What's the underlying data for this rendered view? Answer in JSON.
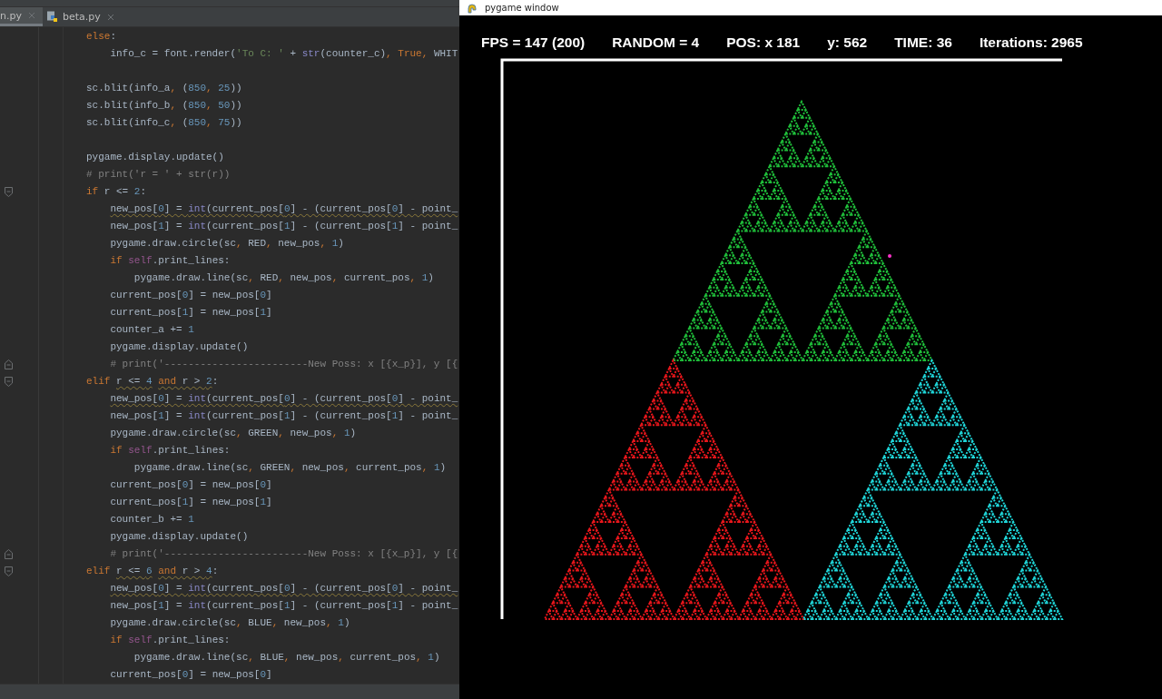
{
  "editor": {
    "tabs": [
      {
        "label": "n.py",
        "selected": true,
        "icon": false
      },
      {
        "label": "beta.py",
        "selected": false,
        "icon": true
      }
    ],
    "lines": [
      {
        "kind": "code",
        "segments": [
          {
            "text": "else",
            "kind": "keyword"
          },
          {
            "text": ":",
            "kind": "plain"
          }
        ]
      },
      {
        "kind": "code",
        "segments": [
          {
            "text": "    info_c = font.render(",
            "kind": "plain"
          },
          {
            "text": "'To C: '",
            "kind": "string"
          },
          {
            "text": " + ",
            "kind": "plain"
          },
          {
            "text": "str",
            "kind": "builtin"
          },
          {
            "text": "(counter_c)",
            "kind": "plain"
          },
          {
            "text": ", True, ",
            "kind": "keyword"
          },
          {
            "text": "WHIT",
            "kind": "plain"
          }
        ]
      },
      {
        "kind": "blank"
      },
      {
        "kind": "code",
        "segments": [
          {
            "text": "sc.blit(info_a",
            "kind": "plain"
          },
          {
            "text": ", ",
            "kind": "keyword"
          },
          {
            "text": "(",
            "kind": "plain"
          },
          {
            "text": "850",
            "kind": "number"
          },
          {
            "text": ", ",
            "kind": "keyword"
          },
          {
            "text": "25",
            "kind": "number"
          },
          {
            "text": "))",
            "kind": "plain"
          }
        ]
      },
      {
        "kind": "code",
        "segments": [
          {
            "text": "sc.blit(info_b",
            "kind": "plain"
          },
          {
            "text": ", ",
            "kind": "keyword"
          },
          {
            "text": "(",
            "kind": "plain"
          },
          {
            "text": "850",
            "kind": "number"
          },
          {
            "text": ", ",
            "kind": "keyword"
          },
          {
            "text": "50",
            "kind": "number"
          },
          {
            "text": "))",
            "kind": "plain"
          }
        ]
      },
      {
        "kind": "code",
        "segments": [
          {
            "text": "sc.blit(info_c",
            "kind": "plain"
          },
          {
            "text": ", ",
            "kind": "keyword"
          },
          {
            "text": "(",
            "kind": "plain"
          },
          {
            "text": "850",
            "kind": "number"
          },
          {
            "text": ", ",
            "kind": "keyword"
          },
          {
            "text": "75",
            "kind": "number"
          },
          {
            "text": "))",
            "kind": "plain"
          }
        ]
      },
      {
        "kind": "blank"
      },
      {
        "kind": "code",
        "segments": [
          {
            "text": "pygame.display.update()",
            "kind": "plain"
          }
        ]
      },
      {
        "kind": "code",
        "segments": [
          {
            "text": "# print('r = ' + str(r))",
            "kind": "comment"
          }
        ]
      },
      {
        "kind": "code",
        "fold_start": true,
        "segments": [
          {
            "text": "if ",
            "kind": "keyword"
          },
          {
            "text": "r <= ",
            "kind": "plain"
          },
          {
            "text": "2",
            "kind": "number"
          },
          {
            "text": ":",
            "kind": "plain"
          }
        ]
      },
      {
        "kind": "code",
        "segments": [
          {
            "text": "    new_pos[",
            "kind": "plain",
            "warning": true
          },
          {
            "text": "0",
            "kind": "number",
            "warning": true
          },
          {
            "text": "] = ",
            "kind": "plain",
            "warning": true
          },
          {
            "text": "int",
            "kind": "builtin",
            "warning": true
          },
          {
            "text": "(current_pos[",
            "kind": "plain",
            "warning": true
          },
          {
            "text": "0",
            "kind": "number",
            "warning": true
          },
          {
            "text": "] - (current_pos[",
            "kind": "plain",
            "warning": true
          },
          {
            "text": "0",
            "kind": "number",
            "warning": true
          },
          {
            "text": "] - point_",
            "kind": "plain",
            "warning": true
          }
        ]
      },
      {
        "kind": "code",
        "segments": [
          {
            "text": "    new_pos[",
            "kind": "plain"
          },
          {
            "text": "1",
            "kind": "number"
          },
          {
            "text": "] = ",
            "kind": "plain"
          },
          {
            "text": "int",
            "kind": "builtin"
          },
          {
            "text": "(current_pos[",
            "kind": "plain"
          },
          {
            "text": "1",
            "kind": "number"
          },
          {
            "text": "] - (current_pos[",
            "kind": "plain"
          },
          {
            "text": "1",
            "kind": "number"
          },
          {
            "text": "] - point_",
            "kind": "plain"
          }
        ]
      },
      {
        "kind": "code",
        "segments": [
          {
            "text": "    pygame.draw.circle(sc",
            "kind": "plain"
          },
          {
            "text": ", ",
            "kind": "keyword"
          },
          {
            "text": "RED",
            "kind": "plain"
          },
          {
            "text": ", ",
            "kind": "keyword"
          },
          {
            "text": "new_pos",
            "kind": "plain"
          },
          {
            "text": ", ",
            "kind": "keyword"
          },
          {
            "text": "1",
            "kind": "number"
          },
          {
            "text": ")",
            "kind": "plain"
          }
        ]
      },
      {
        "kind": "code",
        "segments": [
          {
            "text": "    if ",
            "kind": "keyword"
          },
          {
            "text": "self",
            "kind": "self"
          },
          {
            "text": ".print_lines:",
            "kind": "plain"
          }
        ]
      },
      {
        "kind": "code",
        "segments": [
          {
            "text": "        pygame.draw.line(sc",
            "kind": "plain"
          },
          {
            "text": ", ",
            "kind": "keyword"
          },
          {
            "text": "RED",
            "kind": "plain"
          },
          {
            "text": ", ",
            "kind": "keyword"
          },
          {
            "text": "new_pos",
            "kind": "plain"
          },
          {
            "text": ", ",
            "kind": "keyword"
          },
          {
            "text": "current_pos",
            "kind": "plain"
          },
          {
            "text": ", ",
            "kind": "keyword"
          },
          {
            "text": "1",
            "kind": "number"
          },
          {
            "text": ")",
            "kind": "plain"
          }
        ]
      },
      {
        "kind": "code",
        "segments": [
          {
            "text": "    current_pos[",
            "kind": "plain"
          },
          {
            "text": "0",
            "kind": "number"
          },
          {
            "text": "] = new_pos[",
            "kind": "plain"
          },
          {
            "text": "0",
            "kind": "number"
          },
          {
            "text": "]",
            "kind": "plain"
          }
        ]
      },
      {
        "kind": "code",
        "segments": [
          {
            "text": "    current_pos[",
            "kind": "plain"
          },
          {
            "text": "1",
            "kind": "number"
          },
          {
            "text": "] = new_pos[",
            "kind": "plain"
          },
          {
            "text": "1",
            "kind": "number"
          },
          {
            "text": "]",
            "kind": "plain"
          }
        ]
      },
      {
        "kind": "code",
        "segments": [
          {
            "text": "    counter_a += ",
            "kind": "plain"
          },
          {
            "text": "1",
            "kind": "number"
          }
        ]
      },
      {
        "kind": "code",
        "segments": [
          {
            "text": "    pygame.display.update()",
            "kind": "plain"
          }
        ]
      },
      {
        "kind": "code",
        "fold_end": true,
        "segments": [
          {
            "text": "    # print('------------------------New Poss: x [{x_p}], y [{",
            "kind": "comment"
          }
        ]
      },
      {
        "kind": "code",
        "fold_start": true,
        "segments": [
          {
            "text": "elif ",
            "kind": "keyword"
          },
          {
            "text": "r <= ",
            "kind": "plain",
            "warning": true
          },
          {
            "text": "4",
            "kind": "number",
            "warning": true
          },
          {
            "text": " and ",
            "kind": "keyword",
            "warning": true
          },
          {
            "text": "r > ",
            "kind": "plain",
            "warning": true
          },
          {
            "text": "2",
            "kind": "number",
            "warning": true
          },
          {
            "text": ":",
            "kind": "plain"
          }
        ]
      },
      {
        "kind": "code",
        "segments": [
          {
            "text": "    new_pos[",
            "kind": "plain",
            "warning": true
          },
          {
            "text": "0",
            "kind": "number",
            "warning": true
          },
          {
            "text": "] = ",
            "kind": "plain",
            "warning": true
          },
          {
            "text": "int",
            "kind": "builtin",
            "warning": true
          },
          {
            "text": "(current_pos[",
            "kind": "plain",
            "warning": true
          },
          {
            "text": "0",
            "kind": "number",
            "warning": true
          },
          {
            "text": "] - (current_pos[",
            "kind": "plain",
            "warning": true
          },
          {
            "text": "0",
            "kind": "number",
            "warning": true
          },
          {
            "text": "] - point_",
            "kind": "plain",
            "warning": true
          }
        ]
      },
      {
        "kind": "code",
        "segments": [
          {
            "text": "    new_pos[",
            "kind": "plain"
          },
          {
            "text": "1",
            "kind": "number"
          },
          {
            "text": "] = ",
            "kind": "plain"
          },
          {
            "text": "int",
            "kind": "builtin"
          },
          {
            "text": "(current_pos[",
            "kind": "plain"
          },
          {
            "text": "1",
            "kind": "number"
          },
          {
            "text": "] - (current_pos[",
            "kind": "plain"
          },
          {
            "text": "1",
            "kind": "number"
          },
          {
            "text": "] - point_",
            "kind": "plain"
          }
        ]
      },
      {
        "kind": "code",
        "segments": [
          {
            "text": "    pygame.draw.circle(sc",
            "kind": "plain"
          },
          {
            "text": ", ",
            "kind": "keyword"
          },
          {
            "text": "GREEN",
            "kind": "plain"
          },
          {
            "text": ", ",
            "kind": "keyword"
          },
          {
            "text": "new_pos",
            "kind": "plain"
          },
          {
            "text": ", ",
            "kind": "keyword"
          },
          {
            "text": "1",
            "kind": "number"
          },
          {
            "text": ")",
            "kind": "plain"
          }
        ]
      },
      {
        "kind": "code",
        "segments": [
          {
            "text": "    if ",
            "kind": "keyword"
          },
          {
            "text": "self",
            "kind": "self"
          },
          {
            "text": ".print_lines:",
            "kind": "plain"
          }
        ]
      },
      {
        "kind": "code",
        "segments": [
          {
            "text": "        pygame.draw.line(sc",
            "kind": "plain"
          },
          {
            "text": ", ",
            "kind": "keyword"
          },
          {
            "text": "GREEN",
            "kind": "plain"
          },
          {
            "text": ", ",
            "kind": "keyword"
          },
          {
            "text": "new_pos",
            "kind": "plain"
          },
          {
            "text": ", ",
            "kind": "keyword"
          },
          {
            "text": "current_pos",
            "kind": "plain"
          },
          {
            "text": ", ",
            "kind": "keyword"
          },
          {
            "text": "1",
            "kind": "number"
          },
          {
            "text": ")",
            "kind": "plain"
          }
        ]
      },
      {
        "kind": "code",
        "segments": [
          {
            "text": "    current_pos[",
            "kind": "plain"
          },
          {
            "text": "0",
            "kind": "number"
          },
          {
            "text": "] = new_pos[",
            "kind": "plain"
          },
          {
            "text": "0",
            "kind": "number"
          },
          {
            "text": "]",
            "kind": "plain"
          }
        ]
      },
      {
        "kind": "code",
        "segments": [
          {
            "text": "    current_pos[",
            "kind": "plain"
          },
          {
            "text": "1",
            "kind": "number"
          },
          {
            "text": "] = new_pos[",
            "kind": "plain"
          },
          {
            "text": "1",
            "kind": "number"
          },
          {
            "text": "]",
            "kind": "plain"
          }
        ]
      },
      {
        "kind": "code",
        "segments": [
          {
            "text": "    counter_b += ",
            "kind": "plain"
          },
          {
            "text": "1",
            "kind": "number"
          }
        ]
      },
      {
        "kind": "code",
        "segments": [
          {
            "text": "    pygame.display.update()",
            "kind": "plain"
          }
        ]
      },
      {
        "kind": "code",
        "fold_end": true,
        "segments": [
          {
            "text": "    # print('------------------------New Poss: x [{x_p}], y [{",
            "kind": "comment"
          }
        ]
      },
      {
        "kind": "code",
        "fold_start": true,
        "segments": [
          {
            "text": "elif ",
            "kind": "keyword"
          },
          {
            "text": "r <= ",
            "kind": "plain",
            "warning": true
          },
          {
            "text": "6",
            "kind": "number",
            "warning": true
          },
          {
            "text": " and ",
            "kind": "keyword",
            "warning": true
          },
          {
            "text": "r > ",
            "kind": "plain",
            "warning": true
          },
          {
            "text": "4",
            "kind": "number",
            "warning": true
          },
          {
            "text": ":",
            "kind": "plain"
          }
        ]
      },
      {
        "kind": "code",
        "segments": [
          {
            "text": "    new_pos[",
            "kind": "plain",
            "warning": true
          },
          {
            "text": "0",
            "kind": "number",
            "warning": true
          },
          {
            "text": "] = ",
            "kind": "plain",
            "warning": true
          },
          {
            "text": "int",
            "kind": "builtin",
            "warning": true
          },
          {
            "text": "(current_pos[",
            "kind": "plain",
            "warning": true
          },
          {
            "text": "0",
            "kind": "number",
            "warning": true
          },
          {
            "text": "] - (current_pos[",
            "kind": "plain",
            "warning": true
          },
          {
            "text": "0",
            "kind": "number",
            "warning": true
          },
          {
            "text": "] - point_",
            "kind": "plain",
            "warning": true
          }
        ]
      },
      {
        "kind": "code",
        "segments": [
          {
            "text": "    new_pos[",
            "kind": "plain"
          },
          {
            "text": "1",
            "kind": "number"
          },
          {
            "text": "] = ",
            "kind": "plain"
          },
          {
            "text": "int",
            "kind": "builtin"
          },
          {
            "text": "(current_pos[",
            "kind": "plain"
          },
          {
            "text": "1",
            "kind": "number"
          },
          {
            "text": "] - (current_pos[",
            "kind": "plain"
          },
          {
            "text": "1",
            "kind": "number"
          },
          {
            "text": "] - point_",
            "kind": "plain"
          }
        ]
      },
      {
        "kind": "code",
        "segments": [
          {
            "text": "    pygame.draw.circle(sc",
            "kind": "plain"
          },
          {
            "text": ", ",
            "kind": "keyword"
          },
          {
            "text": "BLUE",
            "kind": "plain"
          },
          {
            "text": ", ",
            "kind": "keyword"
          },
          {
            "text": "new_pos",
            "kind": "plain"
          },
          {
            "text": ", ",
            "kind": "keyword"
          },
          {
            "text": "1",
            "kind": "number"
          },
          {
            "text": ")",
            "kind": "plain"
          }
        ]
      },
      {
        "kind": "code",
        "segments": [
          {
            "text": "    if ",
            "kind": "keyword"
          },
          {
            "text": "self",
            "kind": "self"
          },
          {
            "text": ".print_lines:",
            "kind": "plain"
          }
        ]
      },
      {
        "kind": "code",
        "segments": [
          {
            "text": "        pygame.draw.line(sc",
            "kind": "plain"
          },
          {
            "text": ", ",
            "kind": "keyword"
          },
          {
            "text": "BLUE",
            "kind": "plain"
          },
          {
            "text": ", ",
            "kind": "keyword"
          },
          {
            "text": "new_pos",
            "kind": "plain"
          },
          {
            "text": ", ",
            "kind": "keyword"
          },
          {
            "text": "current_pos",
            "kind": "plain"
          },
          {
            "text": ", ",
            "kind": "keyword"
          },
          {
            "text": "1",
            "kind": "number"
          },
          {
            "text": ")",
            "kind": "plain"
          }
        ]
      },
      {
        "kind": "code",
        "segments": [
          {
            "text": "    current_pos[",
            "kind": "plain"
          },
          {
            "text": "0",
            "kind": "number"
          },
          {
            "text": "] = new_pos[",
            "kind": "plain"
          },
          {
            "text": "0",
            "kind": "number"
          },
          {
            "text": "]",
            "kind": "plain"
          }
        ]
      }
    ]
  },
  "pygame_window": {
    "title": "pygame window",
    "stats": [
      "FPS = 147 (200)",
      "RANDOM = 4",
      "POS: x 181",
      "y: 562",
      "TIME: 36",
      "Iterations: 2965"
    ]
  }
}
